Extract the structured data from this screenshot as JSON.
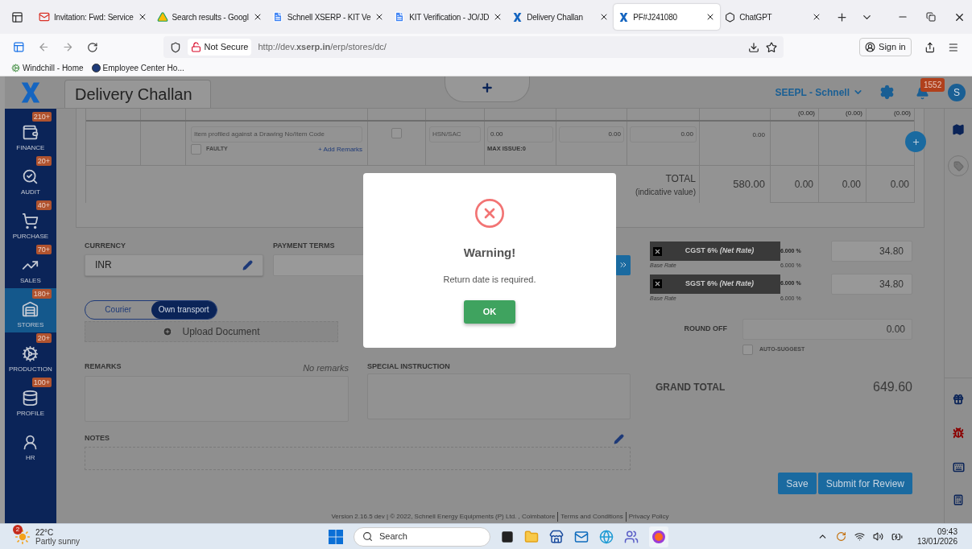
{
  "browser": {
    "tabs": [
      {
        "title": "Invitation: Fwd: Service",
        "kind": "mail",
        "selected": false
      },
      {
        "title": "Search results - Googl",
        "kind": "drive",
        "selected": false
      },
      {
        "title": "Schnell XSERP - KIT Ve",
        "kind": "doc",
        "selected": false
      },
      {
        "title": "KIT Verification - JO/JD",
        "kind": "doc",
        "selected": false
      },
      {
        "title": "Delivery Challan",
        "kind": "app",
        "selected": false
      },
      {
        "title": "PF#J241080",
        "kind": "app",
        "selected": true
      },
      {
        "title": "ChatGPT",
        "kind": "chat",
        "selected": false
      }
    ],
    "security": "Not Secure",
    "url": "http://dev.**xserp.in**/erp/stores/dc/",
    "sign_in": "Sign in",
    "bookmarks": [
      "Windchill - Home",
      "Employee Center Ho..."
    ]
  },
  "sidebar": {
    "items": [
      {
        "label": "FINANCE",
        "badge": "210+",
        "selected": false
      },
      {
        "label": "AUDIT",
        "badge": "20+",
        "selected": false
      },
      {
        "label": "PURCHASE",
        "badge": "40+",
        "selected": false
      },
      {
        "label": "SALES",
        "badge": "70+",
        "selected": false
      },
      {
        "label": "STORES",
        "badge": "180+",
        "selected": true
      },
      {
        "label": "PRODUCTION",
        "badge": "20+",
        "selected": false
      },
      {
        "label": "PROFILE",
        "badge": "100+",
        "selected": false
      },
      {
        "label": "HR",
        "selected": false
      }
    ]
  },
  "header": {
    "page_title": "Delivery Challan",
    "company": "SEEPL - Schnell",
    "notifications": "1552",
    "avatar": "S"
  },
  "table": {
    "header_subtotals": [
      "(0.00)",
      "(0.00)",
      "(0.00)"
    ],
    "item_row": {
      "item_placeholder": "Item profiled against a Drawing No/Item Code",
      "faulty": {
        "label": "FAULTY",
        "checked": false
      },
      "add_remarks": "+ Add Remarks",
      "row_checked": false,
      "hsn_placeholder": "HSN/SAC",
      "quantity": "0.00",
      "max_issue": "MAX ISSUE:0",
      "column_7": "0.00",
      "column_8": "0.00",
      "amount": "0.00"
    },
    "total_row": {
      "label": "TOTAL",
      "sublabel": "(indicative value)",
      "amount": "580.00",
      "columns": [
        "0.00",
        "0.00",
        "0.00"
      ]
    }
  },
  "form": {
    "currency": {
      "label": "CURRENCY",
      "value": "INR"
    },
    "payment_terms": {
      "label": "PAYMENT TERMS"
    },
    "transport": [
      {
        "label": "Courier",
        "selected": false
      },
      {
        "label": "Own transport",
        "selected": true
      }
    ],
    "upload": "Upload Document",
    "remarks": {
      "label": "REMARKS",
      "hint": "No remarks"
    },
    "special_instruction": {
      "label": "SPECIAL INSTRUCTION"
    },
    "notes": {
      "label": "NOTES"
    }
  },
  "taxes": [
    {
      "name": "CGST 6% *(Net Rate)*",
      "rate": "6.000 %",
      "base_label": "Base Rate",
      "base_rate": "6.000 %",
      "amount": "34.80"
    },
    {
      "name": "SGST 6% *(Net Rate)*",
      "rate": "6.000 %",
      "base_label": "Base Rate",
      "base_rate": "6.000 %",
      "amount": "34.80"
    }
  ],
  "round_off": {
    "label": "ROUND OFF",
    "value": "0.00",
    "auto_suggest": {
      "label": "AUTO-SUGGEST",
      "checked": false
    }
  },
  "grand_total": {
    "label": "GRAND TOTAL",
    "value": "649.60"
  },
  "buttons": [
    "Save",
    "Submit for Review"
  ],
  "footer": {
    "text": "Version 2.16.5 dev | © 2022, Schnell Energy Equipments (P) Ltd. , Coimbatore",
    "links": [
      "Terms and Conditions",
      "Privacy Policy"
    ]
  },
  "dialog": {
    "title": "Warning!",
    "message": "Return date is required.",
    "button": "OK"
  },
  "taskbar": {
    "weather_badge": "2",
    "temperature": "22°C",
    "condition": "Partly sunny",
    "search": "Search",
    "time": "09:43",
    "date": "13/01/2026"
  }
}
